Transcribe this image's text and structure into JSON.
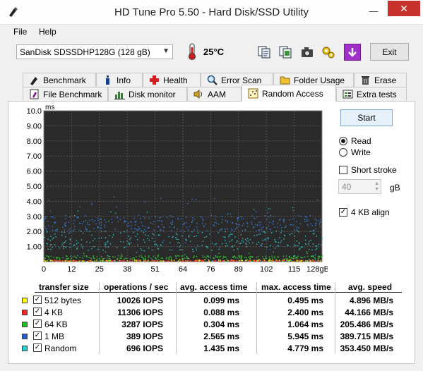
{
  "window": {
    "title": "HD Tune Pro 5.50 - Hard Disk/SSD Utility",
    "minimize": "—",
    "close": "✕"
  },
  "menu": {
    "file": "File",
    "help": "Help"
  },
  "toolbar": {
    "drive": "SanDisk SDSSDHP128G (128 gB)",
    "temperature": "25°C",
    "exit_label": "Exit",
    "icons": [
      "copy-info-icon",
      "copy-screen-icon",
      "camera-icon",
      "options-icon",
      "save-icon"
    ]
  },
  "tabs": {
    "row1": [
      "Benchmark",
      "Info",
      "Health",
      "Error Scan",
      "Folder Usage",
      "Erase"
    ],
    "row2": [
      "File Benchmark",
      "Disk monitor",
      "AAM",
      "Random Access",
      "Extra tests"
    ],
    "active": "Random Access"
  },
  "chart_data": {
    "type": "scatter",
    "y_unit": "ms",
    "y_ticks": [
      "10.0",
      "9.00",
      "8.00",
      "7.00",
      "6.00",
      "5.00",
      "4.00",
      "3.00",
      "2.00",
      "1.00"
    ],
    "x_ticks": [
      "0",
      "12",
      "25",
      "38",
      "51",
      "64",
      "76",
      "89",
      "102",
      "115",
      "128gB"
    ],
    "ylim": [
      0,
      10
    ],
    "xlim": [
      0,
      128
    ],
    "grid": true,
    "series": [
      {
        "name": "512 bytes",
        "color": "#ffff00",
        "avg_ms": 0.099
      },
      {
        "name": "4 KB",
        "color": "#ff3030",
        "avg_ms": 0.088
      },
      {
        "name": "64 KB",
        "color": "#33cc33",
        "avg_ms": 0.304
      },
      {
        "name": "1 MB",
        "color": "#3a7bd5",
        "avg_ms": 2.565
      },
      {
        "name": "Random",
        "color": "#2fc7c7",
        "avg_ms": 1.435
      }
    ]
  },
  "controls": {
    "start_label": "Start",
    "read_label": "Read",
    "write_label": "Write",
    "mode": "Read",
    "short_stroke_label": "Short stroke",
    "short_stroke_checked": false,
    "short_stroke_value": "40",
    "short_stroke_unit": "gB",
    "align_label": "4 KB align",
    "align_checked": true
  },
  "results": {
    "headers": [
      "transfer size",
      "operations / sec",
      "avg. access time",
      "max. access time",
      "avg. speed"
    ],
    "rows": [
      {
        "name": "512 bytes",
        "color": "#ffff00",
        "checked": true,
        "ops": "10026 IOPS",
        "avg": "0.099 ms",
        "max": "0.495 ms",
        "speed": "4.896 MB/s"
      },
      {
        "name": "4 KB",
        "color": "#ff2020",
        "checked": true,
        "ops": "11306 IOPS",
        "avg": "0.088 ms",
        "max": "2.400 ms",
        "speed": "44.166 MB/s"
      },
      {
        "name": "64 KB",
        "color": "#22bb22",
        "checked": true,
        "ops": "3287 IOPS",
        "avg": "0.304 ms",
        "max": "1.064 ms",
        "speed": "205.486 MB/s"
      },
      {
        "name": "1 MB",
        "color": "#2060d0",
        "checked": true,
        "ops": "389 IOPS",
        "avg": "2.565 ms",
        "max": "5.945 ms",
        "speed": "389.715 MB/s"
      },
      {
        "name": "Random",
        "color": "#20d0d0",
        "checked": true,
        "ops": "696 IOPS",
        "avg": "1.435 ms",
        "max": "4.779 ms",
        "speed": "353.450 MB/s"
      }
    ]
  }
}
